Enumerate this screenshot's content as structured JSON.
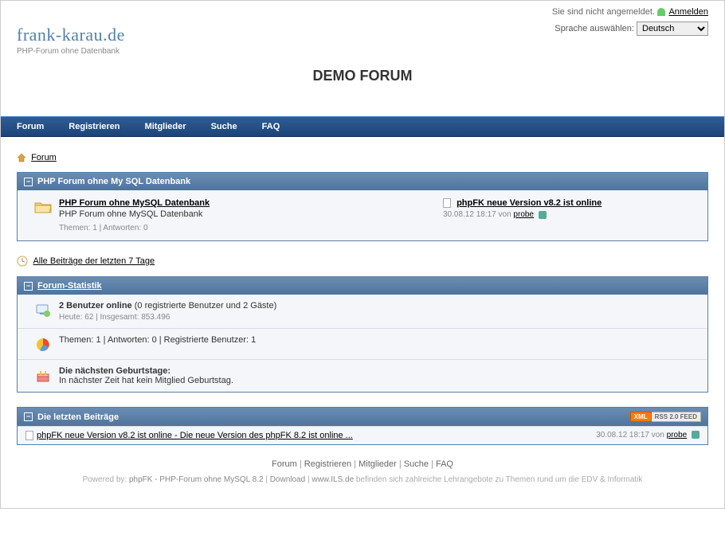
{
  "header": {
    "not_logged_in": "Sie sind nicht angemeldet.",
    "login_link": "Anmelden",
    "lang_label": "Sprache auswählen:",
    "lang_selected": "Deutsch",
    "logo_title": "frank-karau.de",
    "logo_sub": "PHP-Forum ohne Datenbank",
    "demo_title": "DEMO FORUM"
  },
  "nav": {
    "forum": "Forum",
    "register": "Registrieren",
    "members": "Mitglieder",
    "search": "Suche",
    "faq": "FAQ"
  },
  "breadcrumb": "Forum",
  "category": {
    "title": "PHP Forum ohne My SQL Datenbank",
    "forum_name": "PHP Forum ohne MySQL Datenbank",
    "forum_desc": "PHP Forum ohne MySQL Datenbank",
    "forum_meta": "Themen: 1 | Antworten: 0",
    "last_topic": "phpFK neue Version v8.2 ist online",
    "last_time": "30.08.12 18:17 von ",
    "last_user": "probe"
  },
  "recent7": "Alle Beiträge der letzten 7 Tage",
  "stats": {
    "title": "Forum-Statistik",
    "online_bold": "2 Benutzer online",
    "online_detail": " (0 registrierte Benutzer und 2 Gäste)",
    "today": "Heute: 62 | Insgesamt: 853.496",
    "counts": "Themen: 1 | Antworten: 0 | Registrierte Benutzer: 1",
    "bday_title": "Die nächsten Geburtstage:",
    "bday_text": "In nächster Zeit hat kein Mitglied Geburtstag."
  },
  "latest": {
    "title": "Die letzten Beiträge",
    "rss_xml": "XML",
    "rss_feed": "RSS 2.0 FEED",
    "post_title": "phpFK neue Version v8.2 ist online - Die neue Version des phpFK 8.2 ist online ...",
    "post_time": "30.08.12 18:17 von ",
    "post_user": "probe"
  },
  "footer": {
    "nav_forum": "Forum",
    "nav_register": "Registrieren",
    "nav_members": "Mitglieder",
    "nav_search": "Suche",
    "nav_faq": "FAQ",
    "powered": "Powered by: ",
    "product": "phpFK - PHP-Forum ohne MySQL 8.2",
    "download": "Download",
    "ils": "www.ILS.de",
    "ils_text": " befinden sich zahlreiche Lehrangebote zu Themen rund um die EDV & Informatik"
  }
}
